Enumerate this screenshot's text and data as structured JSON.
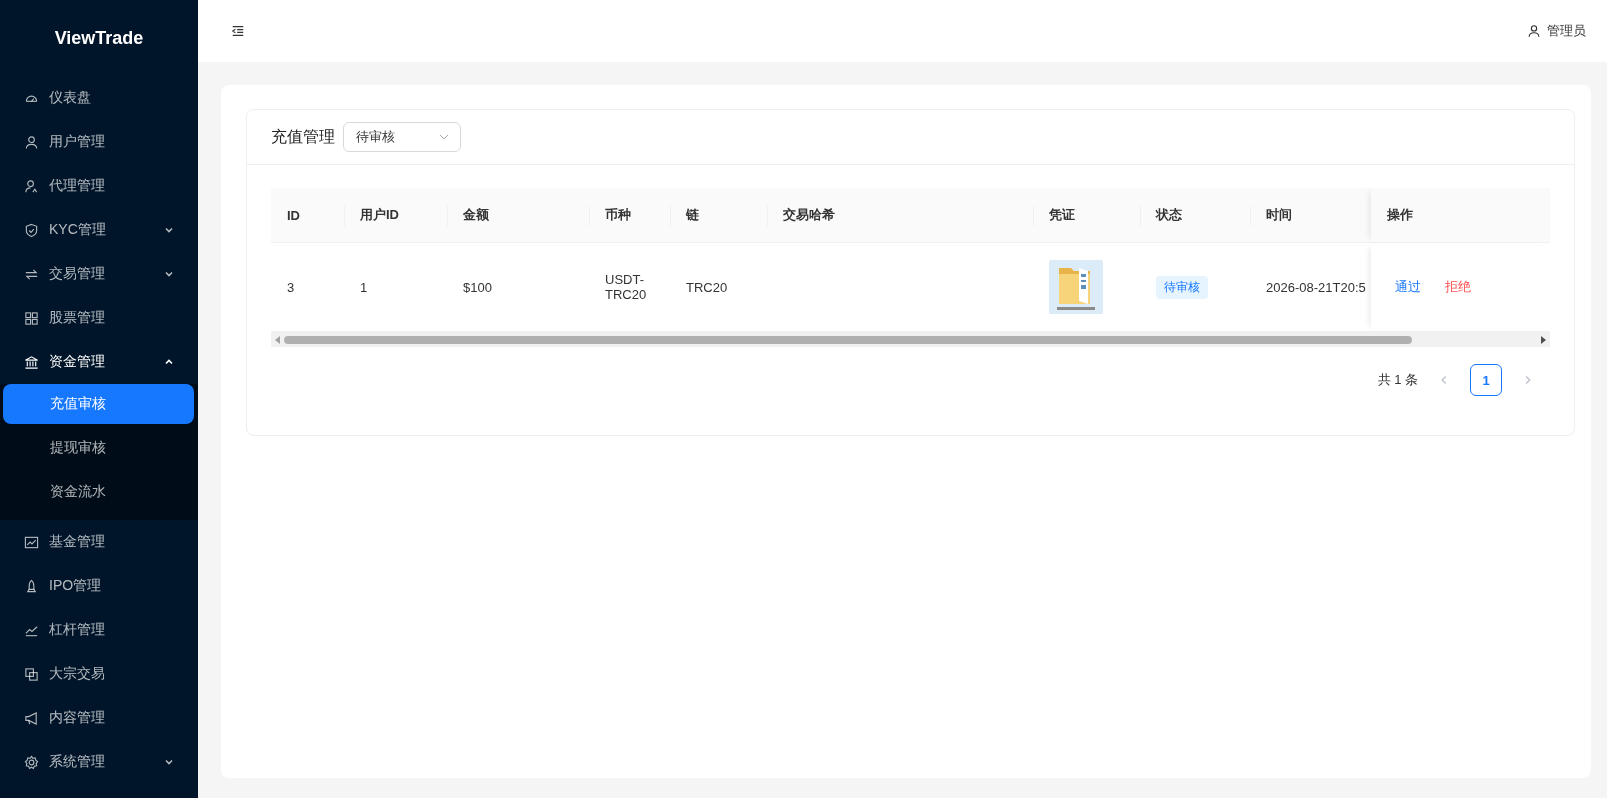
{
  "sidebar": {
    "brand": "ViewTrade",
    "items": [
      {
        "label": "仪表盘",
        "kind": "item",
        "selected": false
      },
      {
        "label": "用户管理",
        "kind": "item",
        "selected": false
      },
      {
        "label": "代理管理",
        "kind": "item",
        "selected": false
      },
      {
        "label": "KYC管理",
        "kind": "group",
        "expanded": false
      },
      {
        "label": "交易管理",
        "kind": "group",
        "expanded": false
      },
      {
        "label": "股票管理",
        "kind": "item",
        "selected": false
      },
      {
        "label": "资金管理",
        "kind": "group",
        "expanded": true,
        "children": [
          {
            "label": "充值审核",
            "selected": true
          },
          {
            "label": "提现审核",
            "selected": false
          },
          {
            "label": "资金流水",
            "selected": false
          }
        ]
      },
      {
        "label": "基金管理",
        "kind": "item",
        "selected": false
      },
      {
        "label": "IPO管理",
        "kind": "item",
        "selected": false
      },
      {
        "label": "杠杆管理",
        "kind": "item",
        "selected": false
      },
      {
        "label": "大宗交易",
        "kind": "item",
        "selected": false
      },
      {
        "label": "内容管理",
        "kind": "item",
        "selected": false
      },
      {
        "label": "系统管理",
        "kind": "group",
        "expanded": false
      }
    ]
  },
  "header": {
    "user": "管理员"
  },
  "card": {
    "title": "充值管理",
    "filter": {
      "value": "待审核"
    }
  },
  "table": {
    "columns": [
      "ID",
      "用户ID",
      "金额",
      "币种",
      "链",
      "交易哈希",
      "凭证",
      "状态",
      "时间",
      "操作"
    ],
    "rows": [
      {
        "id": "3",
        "user_id": "1",
        "amount": "$100",
        "currency": "USDT-TRC20",
        "chain": "TRC20",
        "hash": "",
        "voucher": {
          "kind": "picture"
        },
        "status": "待审核",
        "time": "2026-08-21T20:5",
        "actions": [
          "通过",
          "拒绝"
        ]
      }
    ]
  },
  "pagination": {
    "total": "共 1 条",
    "pages": [
      {
        "label": "1",
        "selected": true
      }
    ]
  }
}
